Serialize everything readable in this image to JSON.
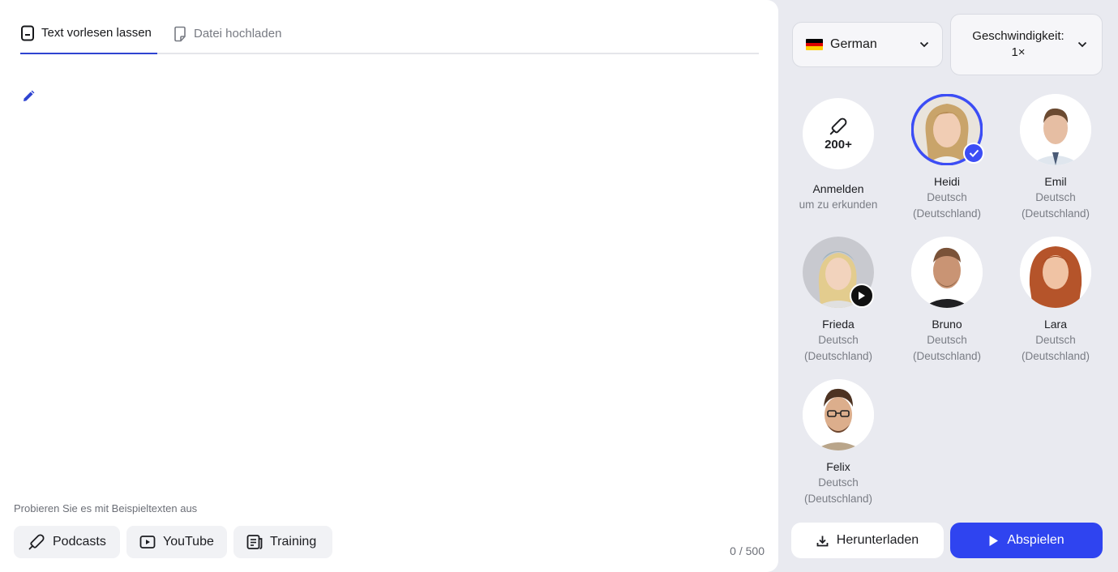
{
  "tabs": [
    {
      "label": "Text vorlesen lassen",
      "icon": "document-text-icon",
      "active": true
    },
    {
      "label": "Datei hochladen",
      "icon": "file-upload-icon",
      "active": false
    }
  ],
  "editor": {
    "edit_icon": "pencil-icon",
    "samples_label": "Probieren Sie es mit Beispieltexten aus",
    "samples": [
      {
        "label": "Podcasts",
        "icon": "microphone-icon"
      },
      {
        "label": "YouTube",
        "icon": "youtube-play-icon"
      },
      {
        "label": "Training",
        "icon": "training-doc-icon"
      }
    ],
    "char_count": "0 / 500"
  },
  "language": {
    "label": "German",
    "flag": "germany-flag-icon"
  },
  "speed": {
    "line1": "Geschwindigkeit:",
    "line2": "1×"
  },
  "signin": {
    "count": "200+",
    "title": "Anmelden",
    "subtitle": "um zu erkunden"
  },
  "voices": [
    {
      "name": "Heidi",
      "lang": "Deutsch",
      "region": "(Deutschland)",
      "selected": true
    },
    {
      "name": "Emil",
      "lang": "Deutsch",
      "region": "(Deutschland)"
    },
    {
      "name": "Frieda",
      "lang": "Deutsch",
      "region": "(Deutschland)",
      "preview": true
    },
    {
      "name": "Bruno",
      "lang": "Deutsch",
      "region": "(Deutschland)"
    },
    {
      "name": "Lara",
      "lang": "Deutsch",
      "region": "(Deutschland)"
    },
    {
      "name": "Felix",
      "lang": "Deutsch",
      "region": "(Deutschland)"
    }
  ],
  "actions": {
    "download": "Herunterladen",
    "play": "Abspielen"
  },
  "colors": {
    "accent": "#2f44f0",
    "selected_ring": "#3c4df5",
    "panel": "#e9eaf0"
  }
}
